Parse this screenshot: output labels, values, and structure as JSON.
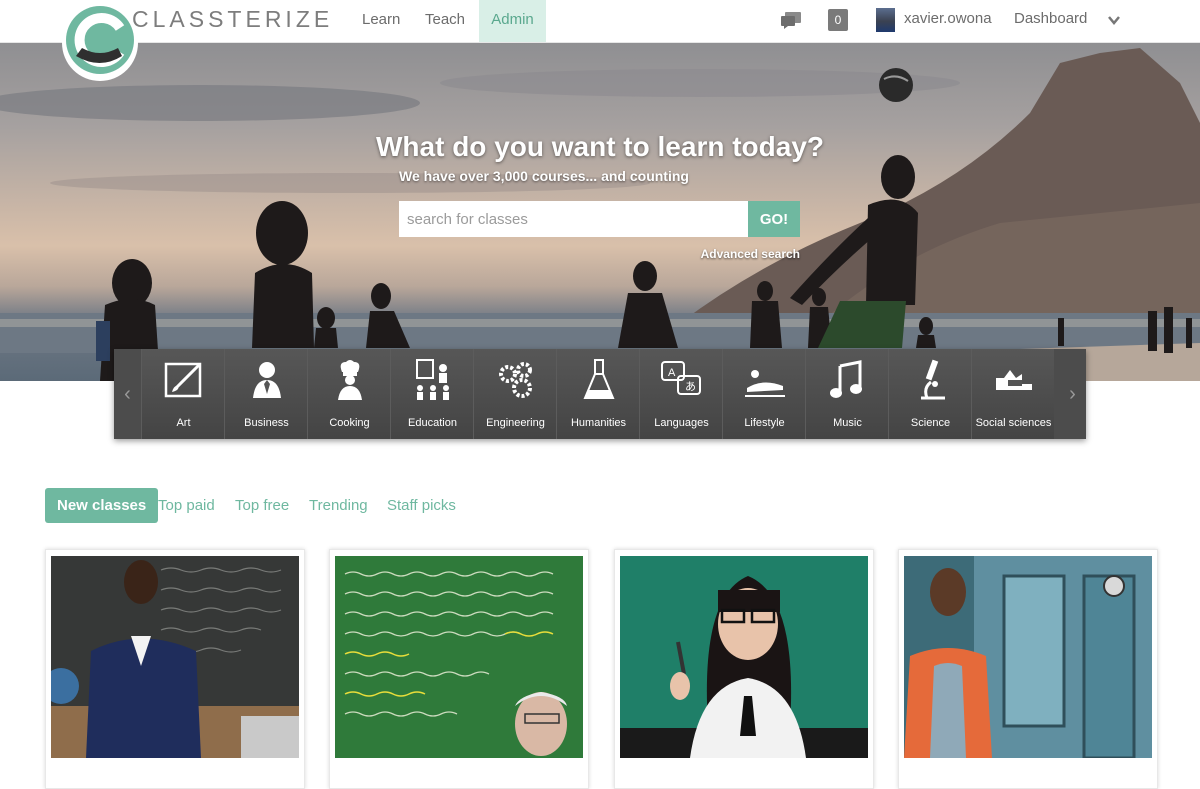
{
  "brand": "CLASSTERIZE",
  "nav": {
    "learn": "Learn",
    "teach": "Teach",
    "admin": "Admin"
  },
  "user": {
    "name": "xavier.owona",
    "notifications": "0",
    "dashboard": "Dashboard"
  },
  "hero": {
    "title": "What do you want to learn today?",
    "subtitle": "We have over 3,000 courses... and counting",
    "search_placeholder": "search for classes",
    "go_label": "GO!",
    "advanced_search": "Advanced search"
  },
  "categories": [
    {
      "label": "Art",
      "icon": "art-icon"
    },
    {
      "label": "Business",
      "icon": "business-icon"
    },
    {
      "label": "Cooking",
      "icon": "cooking-icon"
    },
    {
      "label": "Education",
      "icon": "education-icon"
    },
    {
      "label": "Engineering",
      "icon": "engineering-icon"
    },
    {
      "label": "Humanities",
      "icon": "humanities-icon"
    },
    {
      "label": "Languages",
      "icon": "languages-icon"
    },
    {
      "label": "Lifestyle",
      "icon": "lifestyle-icon"
    },
    {
      "label": "Music",
      "icon": "music-icon"
    },
    {
      "label": "Science",
      "icon": "science-icon"
    },
    {
      "label": "Social sciences",
      "icon": "social-sciences-icon"
    }
  ],
  "tabs": [
    "New classes",
    "Top paid",
    "Top free",
    "Trending",
    "Staff picks"
  ],
  "colors": {
    "accent": "#6fb8a0",
    "accent_light": "#d9efe7",
    "category_bar": "#4c4c4c"
  }
}
